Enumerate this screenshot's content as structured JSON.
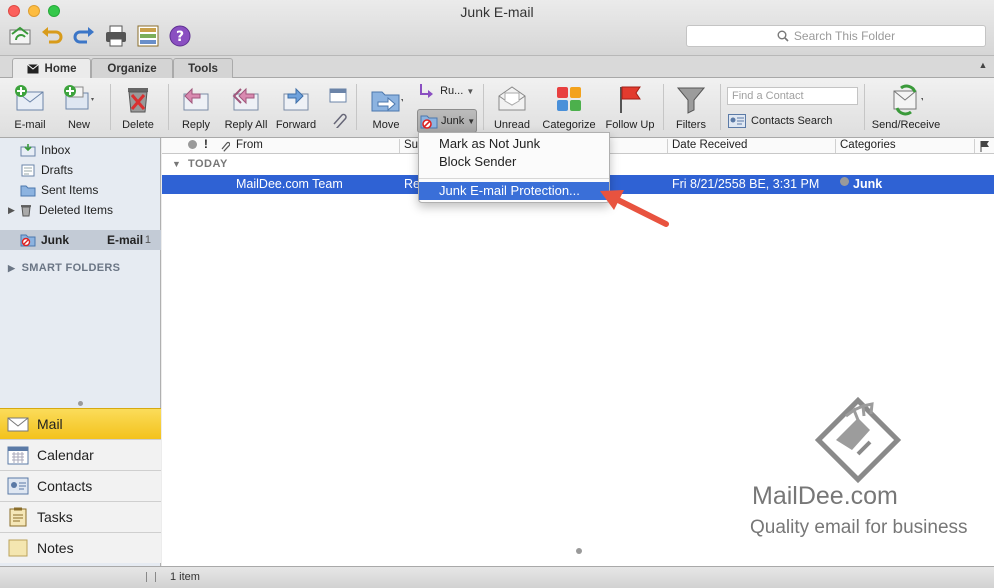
{
  "window": {
    "title": "Junk E-mail"
  },
  "search": {
    "placeholder": "Search This Folder"
  },
  "tabs": [
    {
      "label": "Home"
    },
    {
      "label": "Organize"
    },
    {
      "label": "Tools"
    }
  ],
  "ribbon": {
    "email": "E-mail",
    "new": "New",
    "delete": "Delete",
    "reply": "Reply",
    "reply_all": "Reply All",
    "forward": "Forward",
    "move": "Move",
    "rules": "Ru...",
    "junk": "Junk",
    "unread": "Unread",
    "categorize": "Categorize",
    "follow_up": "Follow Up",
    "filters": "Filters",
    "find_contact_placeholder": "Find a Contact",
    "contacts_search": "Contacts Search",
    "send_receive": "Send/Receive"
  },
  "sidebar": {
    "folders": [
      {
        "label": "Inbox"
      },
      {
        "label": "Drafts"
      },
      {
        "label": "Sent Items"
      },
      {
        "label": "Deleted Items"
      }
    ],
    "junk": {
      "label": "Junk",
      "label2": "E-mail",
      "count": "1"
    },
    "smart_folders": "SMART FOLDERS",
    "nav": [
      {
        "label": "Mail"
      },
      {
        "label": "Calendar"
      },
      {
        "label": "Contacts"
      },
      {
        "label": "Tasks"
      },
      {
        "label": "Notes"
      }
    ]
  },
  "list": {
    "columns": {
      "from": "From",
      "subject": "Su",
      "date": "Date Received",
      "categories": "Categories"
    },
    "group": "TODAY",
    "message": {
      "from": "MailDee.com Team",
      "subject": "Re",
      "date": "Fri 8/21/2558 BE, 3:31 PM",
      "category": "Junk"
    }
  },
  "menu": {
    "mark_not_junk": "Mark as Not Junk",
    "block_sender": "Block Sender",
    "protection": "Junk E-mail Protection..."
  },
  "watermark": {
    "brand": "MailDee.com",
    "tagline": "Quality email for business"
  },
  "status": {
    "count": "1 item"
  },
  "colors": {
    "selection": "#2f62d4",
    "mail_nav": "#f3c21c",
    "arrow": "#e8533f"
  }
}
